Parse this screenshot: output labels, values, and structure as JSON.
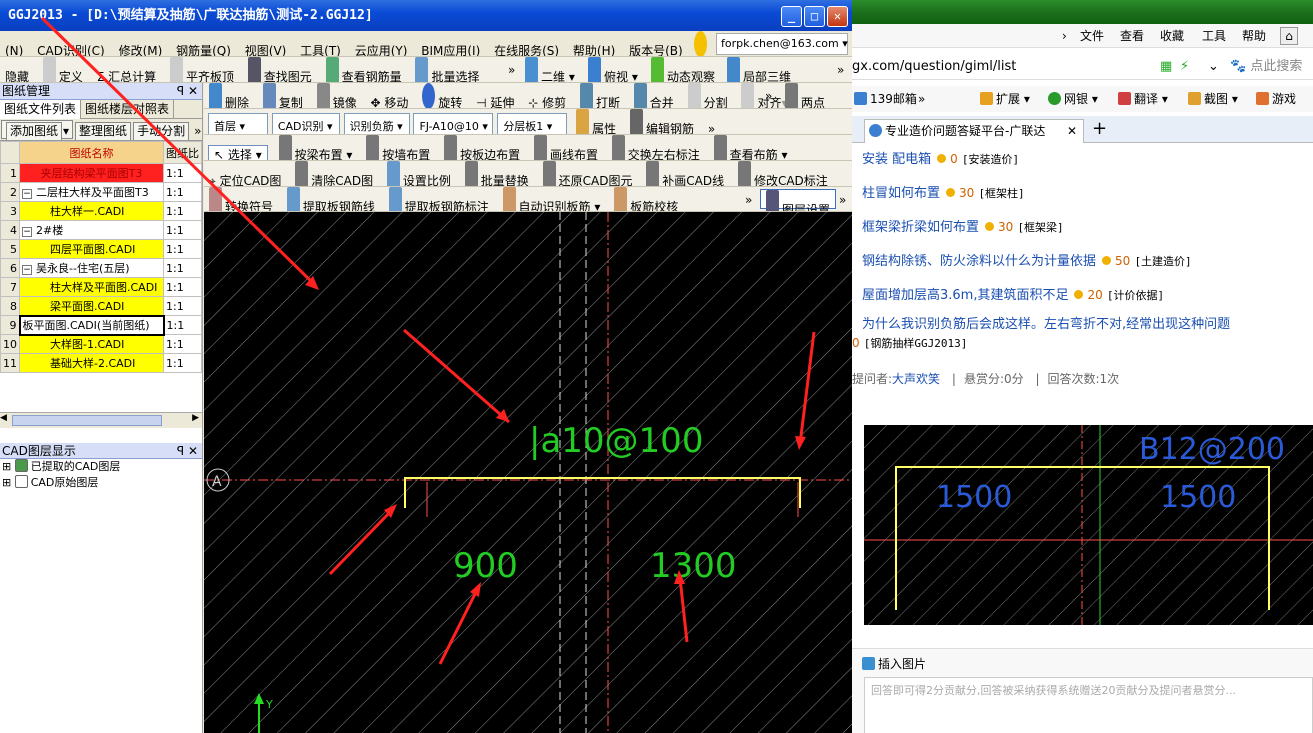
{
  "window": {
    "title": "GGJ2013 - [D:\\预结算及抽筋\\广联达抽筋\\测试-2.GGJ12]"
  },
  "menu": {
    "items": [
      "(N)",
      "CAD识别(C)",
      "修改(M)",
      "钢筋量(Q)",
      "视图(V)",
      "工具(T)",
      "云应用(Y)",
      "BIM应用(I)",
      "在线服务(S)",
      "帮助(H)",
      "版本号(B)"
    ],
    "account": "forpk.chen@163.com"
  },
  "toolbar1": {
    "items": [
      "隐藏",
      "定义",
      "汇总计算",
      "平齐板顶",
      "查找图元",
      "查看钢筋量",
      "批量选择"
    ],
    "view2d": "二维",
    "view_top": "俯视",
    "dynamic": "动态观察",
    "local3d": "局部三维"
  },
  "toolbar2": {
    "items": [
      "删除",
      "复制",
      "镜像",
      "移动",
      "旋转",
      "延伸",
      "修剪",
      "打断",
      "合并",
      "分割",
      "对齐"
    ],
    "twopoint": "两点"
  },
  "toolbar3": {
    "floor": "首层",
    "cad": "CAD识别",
    "recog": "识别负筋",
    "rebar": "FJ-A10@10",
    "layer": "分层板1",
    "props": "属性",
    "edit": "编辑钢筋"
  },
  "toolbar4": {
    "items": [
      "选择",
      "按梁布置",
      "按墙布置",
      "按板边布置",
      "画线布置",
      "交换左右标注",
      "查看布筋"
    ]
  },
  "toolbar5": {
    "items": [
      "定位CAD图",
      "清除CAD图",
      "设置比例",
      "批量替换",
      "还原CAD图元",
      "补画CAD线",
      "修改CAD标注"
    ]
  },
  "toolbar6": {
    "items": [
      "转换符号",
      "提取板钢筋线",
      "提取板钢筋标注",
      "自动识别板筋",
      "板筋校核",
      "图层设置"
    ]
  },
  "drawing_panel": {
    "title": "图纸管理",
    "tabs": [
      "图纸文件列表",
      "图纸楼层对照表"
    ],
    "buttons": [
      "添加图纸",
      "整理图纸",
      "手动分割"
    ],
    "col_name": "图纸名称",
    "col_scale": "图纸比",
    "rows": [
      {
        "n": "1",
        "name": "夹层结构梁平面图T3",
        "scale": "1:1",
        "style": "red",
        "indent": 0,
        "exp": ""
      },
      {
        "n": "2",
        "name": "二层柱大样及平面图T3",
        "scale": "1:1",
        "style": "",
        "indent": 0,
        "exp": "−"
      },
      {
        "n": "3",
        "name": "柱大样一.CADI",
        "scale": "1:1",
        "style": "yel",
        "indent": 1,
        "exp": ""
      },
      {
        "n": "4",
        "name": "2#楼",
        "scale": "1:1",
        "style": "",
        "indent": 0,
        "exp": "−"
      },
      {
        "n": "5",
        "name": "四层平面图.CADI",
        "scale": "1:1",
        "style": "yel",
        "indent": 1,
        "exp": ""
      },
      {
        "n": "6",
        "name": "吴永良--住宅(五层)",
        "scale": "1:1",
        "style": "",
        "indent": 0,
        "exp": "−"
      },
      {
        "n": "7",
        "name": "柱大样及平面图.CADI",
        "scale": "1:1",
        "style": "yel",
        "indent": 1,
        "exp": ""
      },
      {
        "n": "8",
        "name": "梁平面图.CADI",
        "scale": "1:1",
        "style": "yel",
        "indent": 1,
        "exp": ""
      },
      {
        "n": "9",
        "name": "板平面图.CADI(当前图纸)",
        "scale": "1:1",
        "style": "cur",
        "indent": 0,
        "exp": ""
      },
      {
        "n": "10",
        "name": "大样图-1.CADI",
        "scale": "1:1",
        "style": "yel",
        "indent": 1,
        "exp": ""
      },
      {
        "n": "11",
        "name": "基础大样-2.CADI",
        "scale": "1:1",
        "style": "yel",
        "indent": 1,
        "exp": ""
      }
    ]
  },
  "layer_panel": {
    "title": "CAD图层显示",
    "items": [
      "已提取的CAD图层",
      "CAD原始图层"
    ]
  },
  "cad": {
    "rebar_label": "|a10@100",
    "dim_left": "900",
    "dim_right": "1300",
    "axis": "A",
    "axis_y": "Y"
  },
  "browser": {
    "tab_top": [
      "文件",
      "查看",
      "收藏",
      "工具",
      "帮助"
    ],
    "url": "gx.com/question/giml/list",
    "search_placeholder": "点此搜索",
    "favbar": [
      "139邮箱",
      "扩展",
      "网银",
      "翻译",
      "截图",
      "游戏"
    ],
    "tab_title": "专业造价问题答疑平台-广联达",
    "questions": [
      {
        "title": "安装 配电箱",
        "points": "0",
        "cat": "[安装造价]"
      },
      {
        "title": "柱冒如何布置",
        "points": "30",
        "cat": "[框架柱]"
      },
      {
        "title": "框架梁折梁如何布置",
        "points": "30",
        "cat": "[框架梁]"
      },
      {
        "title": "钢结构除锈、防火涂料以什么为计量依据",
        "points": "50",
        "cat": "[土建造价]"
      },
      {
        "title": "屋面增加层高3.6m,其建筑面积不足",
        "points": "20",
        "cat": "[计价依据]"
      }
    ],
    "main_q": {
      "title": "为什么我识别负筋后会成这样。左右弯折不对,经常出现这种问题",
      "points": "0",
      "cat": "[钢筋抽样GGJ2013]"
    },
    "meta": {
      "asker_label": "提问者:",
      "asker": "大声欢笑",
      "reward": "悬赏分:0分",
      "answers": "回答次数:1次"
    },
    "img": {
      "label": "B12@200",
      "d1": "1500",
      "d2": "1500"
    },
    "insert_image": "插入图片",
    "answer_placeholder": "回答即可得2分贡献分,回答被采纳获得系统赠送20贡献分及提问者悬赏分..."
  }
}
